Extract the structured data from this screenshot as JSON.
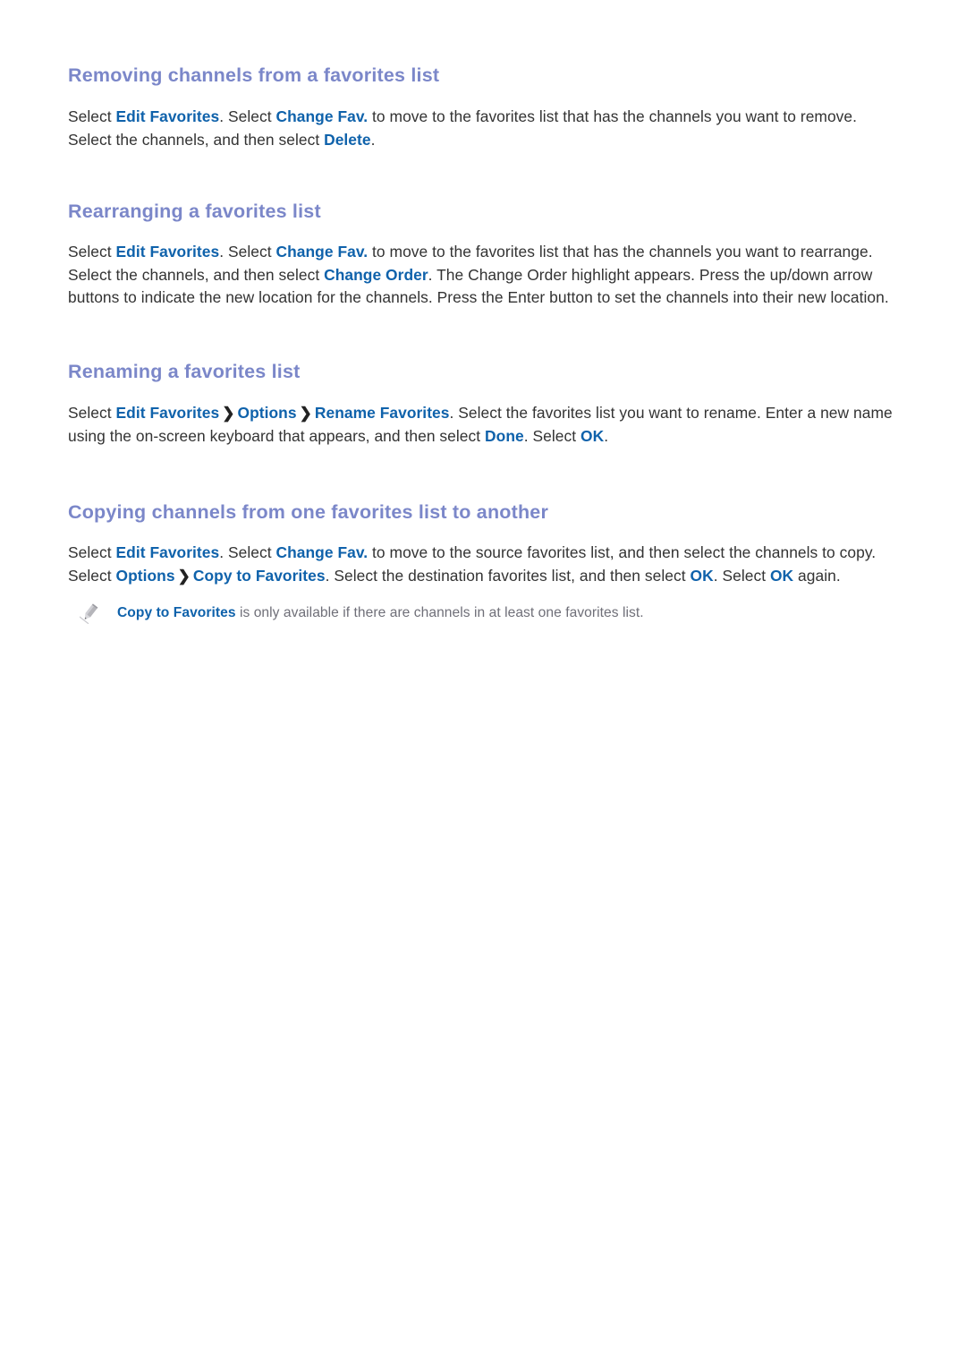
{
  "document": {
    "background_color": "#ffffff",
    "heading_color": "#7b87c9",
    "link_color": "#0f62ab",
    "body_text_color": "#333333",
    "note_text_color": "#6f6f78"
  },
  "sections": [
    {
      "heading": "Removing channels from a favorites list",
      "paragraph": {
        "p1": "Select ",
        "l1": "Edit Favorites",
        "p2": ". Select ",
        "l2": "Change Fav.",
        "p3": " to move to the favorites list that has the channels you want to remove. Select the channels, and then select ",
        "l3": "Delete",
        "p4": "."
      }
    },
    {
      "heading": "Rearranging a favorites list",
      "paragraph": {
        "p1": "Select ",
        "l1": "Edit Favorites",
        "p2": ". Select ",
        "l2": "Change Fav.",
        "p3": " to move to the favorites list that has the channels you want to rearrange. Select the channels, and then select ",
        "l3": "Change Order",
        "p4": ". The Change Order highlight appears. Press the up/down arrow buttons to indicate the new location for the channels. Press the Enter button to set the channels into their new location."
      }
    },
    {
      "heading": "Renaming a favorites list",
      "paragraph": {
        "p1": "Select ",
        "l1": "Edit Favorites",
        "sep1": "❯",
        "l2": "Options",
        "sep2": "❯",
        "l3": "Rename Favorites",
        "p2": ". Select the favorites list you want to rename. Enter a new name using the on-screen keyboard that appears, and then select ",
        "l4": "Done",
        "p3": ". Select ",
        "l5": "OK",
        "p4": "."
      }
    },
    {
      "heading": "Copying channels from one favorites list to another",
      "paragraph": {
        "p1": "Select ",
        "l1": "Edit Favorites",
        "p2": ". Select ",
        "l2": "Change Fav.",
        "p3": " to move to the source favorites list, and then select the channels to copy. Select ",
        "l3": "Options",
        "sep1": "❯",
        "l4": "Copy to Favorites",
        "p4": ". Select the destination favorites list, and then select ",
        "l5": "OK",
        "p5": ". Select ",
        "l6": "OK",
        "p6": " again."
      },
      "note": {
        "icon": "pencil-icon",
        "link": "Copy to Favorites",
        "text": " is only available if there are channels in at least one favorites list."
      }
    }
  ]
}
